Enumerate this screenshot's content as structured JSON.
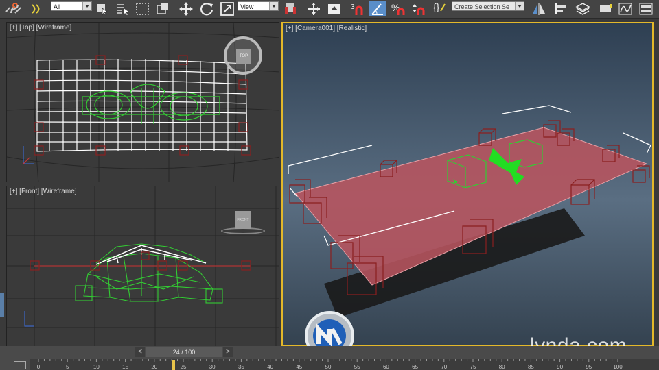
{
  "toolbar": {
    "selection_filter": "All",
    "reference_coordinate": "View",
    "snap_number": "3",
    "selection_set_placeholder": "Create Selection Se",
    "icons": [
      "link-icon",
      "unlink-icon",
      "bind-spacewarp-icon",
      "select-object-icon",
      "select-by-name-icon",
      "rect-region-icon",
      "window-crossing-icon",
      "move-icon",
      "rotate-icon",
      "scale-icon",
      "pivot-icon",
      "select-manipulate-icon",
      "snaps-toggle-icon",
      "angle-snap-icon",
      "percent-snap-icon",
      "spinner-snap-icon",
      "edit-named-sets-icon",
      "mirror-icon",
      "align-icon",
      "layer-manager-icon",
      "render-setup-icon",
      "curve-editor-icon",
      "schematic-view-icon"
    ]
  },
  "viewports": {
    "top": {
      "label": "[+] [Top] [Wireframe]",
      "viewcube_label": "TOP"
    },
    "front": {
      "label": "[+] [Front] [Wireframe]",
      "viewcube_label": "FRONT"
    },
    "camera": {
      "label": "[+] [Camera001] [Realistic]"
    }
  },
  "timeline": {
    "frame_display": "24 / 100",
    "ticks": [
      "0",
      "5",
      "10",
      "15",
      "20",
      "25",
      "30",
      "35",
      "40",
      "45",
      "50",
      "55",
      "60",
      "65",
      "70",
      "75",
      "80",
      "85",
      "90",
      "95",
      "100"
    ]
  },
  "watermark": {
    "text": "lynda.com"
  },
  "colors": {
    "ui_bg": "#444444",
    "viewport_bg": "#3a3a3a",
    "wire_green": "#33cc33",
    "selected_wire": "#ffffff",
    "box_red": "#8a1f1f",
    "plane_red": "#b8545e",
    "active_border": "#e3b82a"
  }
}
